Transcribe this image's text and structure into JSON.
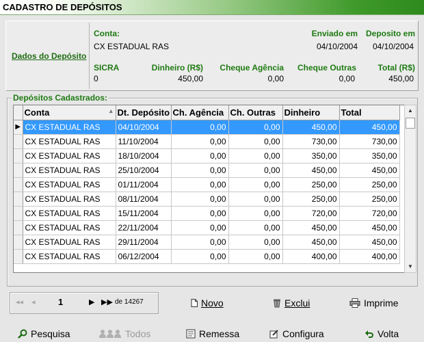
{
  "window": {
    "title": "CADASTRO DE DEPÓSITOS"
  },
  "summary": {
    "section_link": "Dados do Depósito",
    "conta_label": "Conta:",
    "conta_value": "CX ESTADUAL RAS",
    "enviado_label": "Enviado em",
    "enviado_value": "04/10/2004",
    "deposito_label": "Deposito em",
    "deposito_value": "04/10/2004",
    "sicra_label": "SICRA",
    "sicra_value": "0",
    "dinheiro_label": "Dinheiro (R$)",
    "dinheiro_value": "450,00",
    "cheque_agencia_label": "Cheque Agência",
    "cheque_agencia_value": "0,00",
    "cheque_outras_label": "Cheque Outras",
    "cheque_outras_value": "0,00",
    "total_label": "Total (R$)",
    "total_value": "450,00"
  },
  "grid": {
    "group_title": "Depósitos Cadastrados:",
    "columns": [
      "Conta",
      "Dt. Depósito",
      "Ch. Agência",
      "Ch. Outras",
      "Dinheiro",
      "Total"
    ],
    "rows": [
      [
        "CX ESTADUAL RAS",
        "04/10/2004",
        "0,00",
        "0,00",
        "450,00",
        "450,00"
      ],
      [
        "CX ESTADUAL RAS",
        "11/10/2004",
        "0,00",
        "0,00",
        "730,00",
        "730,00"
      ],
      [
        "CX ESTADUAL RAS",
        "18/10/2004",
        "0,00",
        "0,00",
        "350,00",
        "350,00"
      ],
      [
        "CX ESTADUAL RAS",
        "25/10/2004",
        "0,00",
        "0,00",
        "450,00",
        "450,00"
      ],
      [
        "CX ESTADUAL RAS",
        "01/11/2004",
        "0,00",
        "0,00",
        "250,00",
        "250,00"
      ],
      [
        "CX ESTADUAL RAS",
        "08/11/2004",
        "0,00",
        "0,00",
        "250,00",
        "250,00"
      ],
      [
        "CX ESTADUAL RAS",
        "15/11/2004",
        "0,00",
        "0,00",
        "720,00",
        "720,00"
      ],
      [
        "CX ESTADUAL RAS",
        "22/11/2004",
        "0,00",
        "0,00",
        "450,00",
        "450,00"
      ],
      [
        "CX ESTADUAL RAS",
        "29/11/2004",
        "0,00",
        "0,00",
        "450,00",
        "450,00"
      ],
      [
        "CX ESTADUAL RAS",
        "06/12/2004",
        "0,00",
        "0,00",
        "400,00",
        "400,00"
      ]
    ]
  },
  "navigator": {
    "current_page": "1",
    "total_label": "de 14267"
  },
  "actions": {
    "novo": "Novo",
    "exclui": "Exclui",
    "imprime": "Imprime"
  },
  "bottom": {
    "pesquisa": "Pesquisa",
    "todos": "Todos",
    "remessa": "Remessa",
    "configura": "Configura",
    "volta": "Volta"
  }
}
